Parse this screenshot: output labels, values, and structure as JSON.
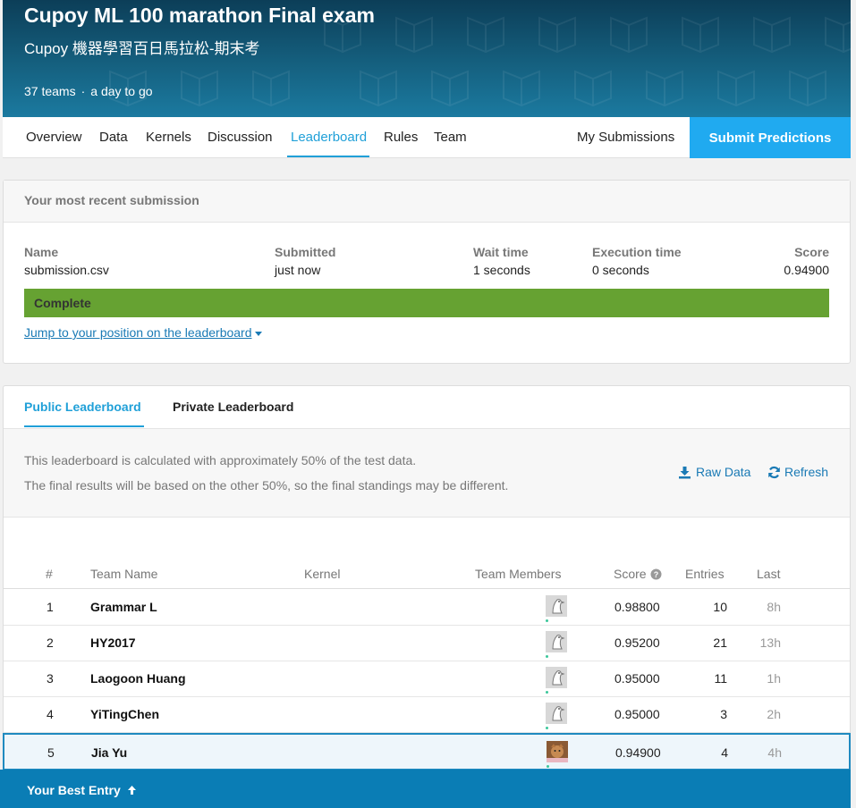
{
  "header": {
    "title": "Cupoy ML 100 marathon Final exam",
    "subtitle": "Cupoy 機器學習百日馬拉松-期末考",
    "teams": "37 teams",
    "separator": "·",
    "deadline": "a day to go"
  },
  "nav": {
    "tabs": [
      "Overview",
      "Data",
      "Kernels",
      "Discussion",
      "Leaderboard",
      "Rules",
      "Team"
    ],
    "active_tab": "Leaderboard",
    "my_submissions": "My Submissions",
    "submit_button": "Submit Predictions"
  },
  "submission": {
    "heading": "Your most recent submission",
    "columns": [
      {
        "label": "Name",
        "value": "submission.csv"
      },
      {
        "label": "Submitted",
        "value": "just now"
      },
      {
        "label": "Wait time",
        "value": "1 seconds"
      },
      {
        "label": "Execution time",
        "value": "0 seconds"
      },
      {
        "label": "Score",
        "value": "0.94900"
      }
    ],
    "status": "Complete",
    "jump_link": "Jump to your position on the leaderboard"
  },
  "leaderboard": {
    "tabs": [
      "Public Leaderboard",
      "Private Leaderboard"
    ],
    "active_tab": "Public Leaderboard",
    "info_line1": "This leaderboard is calculated with approximately 50% of the test data.",
    "info_line2": "The final results will be based on the other 50%, so the final standings may be different.",
    "raw_data": "Raw Data",
    "refresh": "Refresh",
    "columns": {
      "rank": "#",
      "team_name": "Team Name",
      "kernel": "Kernel",
      "members": "Team Members",
      "score": "Score",
      "entries": "Entries",
      "last": "Last"
    },
    "rows": [
      {
        "rank": "1",
        "team": "Grammar L",
        "score": "0.98800",
        "entries": "10",
        "last": "8h",
        "avatar": "bird-avatar"
      },
      {
        "rank": "2",
        "team": "HY2017",
        "score": "0.95200",
        "entries": "21",
        "last": "13h",
        "avatar": "bird-avatar"
      },
      {
        "rank": "3",
        "team": "Laogoon Huang",
        "score": "0.95000",
        "entries": "11",
        "last": "1h",
        "avatar": "bird-avatar"
      },
      {
        "rank": "4",
        "team": "YiTingChen",
        "score": "0.95000",
        "entries": "3",
        "last": "2h",
        "avatar": "bird-avatar"
      },
      {
        "rank": "5",
        "team": "Jia Yu",
        "score": "0.94900",
        "entries": "4",
        "last": "4h",
        "avatar": "photo-avatar",
        "highlight": true
      }
    ],
    "best_entry": "Your Best Entry"
  },
  "colors": {
    "accent": "#20a0d8",
    "submit_bg": "#20aaf0",
    "complete_bar": "#66a232",
    "best_entry_bar": "#0a7db5",
    "header_dark": "#0c3e58"
  }
}
